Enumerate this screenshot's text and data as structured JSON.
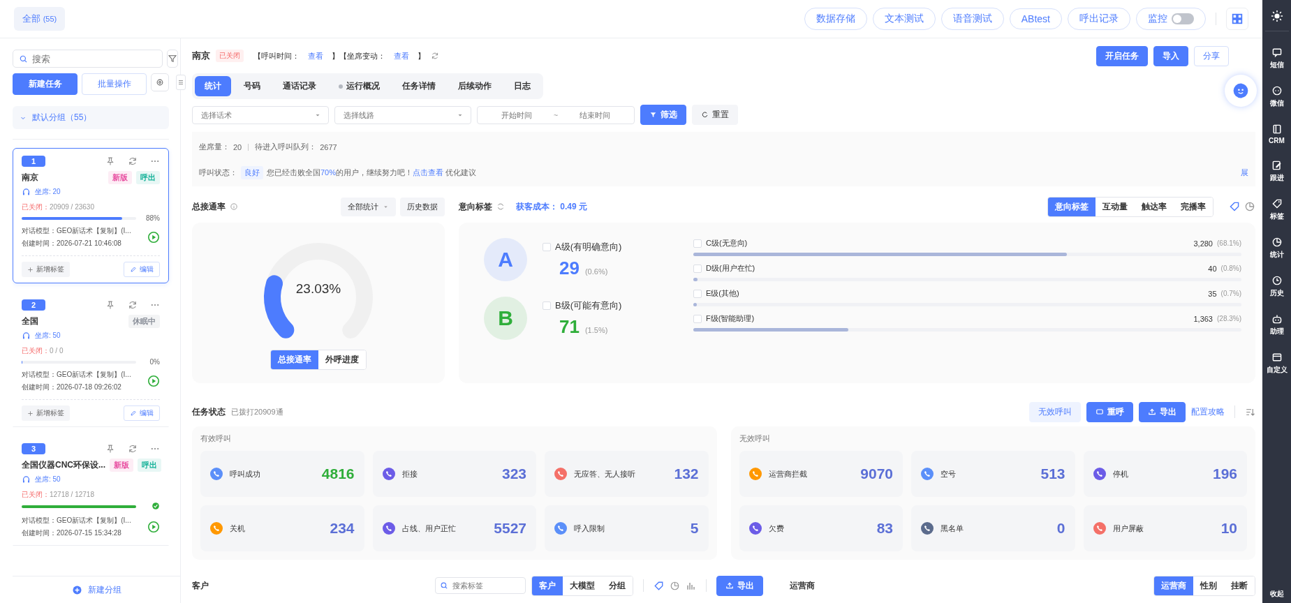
{
  "top_bar": {
    "all_tab": {
      "label": "全部",
      "count": "(55)"
    },
    "buttons": [
      "数据存储",
      "文本测试",
      "语音测试",
      "ABtest",
      "呼出记录"
    ],
    "monitor": {
      "label": "监控",
      "on": false
    }
  },
  "left_panel": {
    "search_placeholder": "搜索",
    "new_task": "新建任务",
    "batch": "批量操作",
    "group": {
      "label": "默认分组（55）",
      "expanded": true
    },
    "tasks": [
      {
        "number": "1",
        "name": "南京",
        "selected": true,
        "tags": [
          {
            "label": "新版",
            "color": "#e84fa1"
          },
          {
            "label": "呼出",
            "color": "#19b39b"
          }
        ],
        "seats": "坐席: 20",
        "closed_label": "已关闭：",
        "closed_value": "20909 / 23630",
        "level": 0.88,
        "percent": "88%",
        "done": false,
        "model": "对话模型：GEO新话术【复制】(I...",
        "created": "创建时间：2026-07-21 10:46:08",
        "add_tag": "新增标签",
        "edit": "编辑"
      },
      {
        "number": "2",
        "name": "全国",
        "selected": false,
        "tags": [
          {
            "label": "休眠中",
            "color": "#8a8f99"
          }
        ],
        "seats": "坐席: 50",
        "closed_label": "已关闭：",
        "closed_value": "0 / 0",
        "level": 0,
        "percent": "0%",
        "done": false,
        "model": "对话模型：GEO新话术【复制】(I...",
        "created": "创建时间：2026-07-18 09:26:02",
        "add_tag": "新增标签",
        "edit": "编辑"
      },
      {
        "number": "3",
        "name": "全国仪器CNC环保设...",
        "selected": false,
        "tags": [
          {
            "label": "新版",
            "color": "#e84fa1"
          },
          {
            "label": "呼出",
            "color": "#19b39b"
          }
        ],
        "seats": "坐席: 50",
        "closed_label": "已关闭：",
        "closed_value": "12718 / 12718",
        "level": 1,
        "done": true,
        "model": "对话模型：GEO新话术【复制】(I...",
        "created": "创建时间：2026-07-15 15:34:28"
      }
    ],
    "new_group": "新建分组"
  },
  "header": {
    "title": "南京",
    "status": "已关闭",
    "meta": [
      {
        "text": "【呼叫时间：",
        "kind": "text"
      },
      {
        "text": "查看",
        "kind": "link"
      },
      {
        "text": "】【坐席变动：",
        "kind": "text"
      },
      {
        "text": "查看",
        "kind": "link"
      },
      {
        "text": "】",
        "kind": "text"
      }
    ],
    "actions": [
      {
        "label": "开启任务",
        "kind": "primary"
      },
      {
        "label": "导入",
        "kind": "primary"
      },
      {
        "label": "分享",
        "kind": "outline"
      }
    ]
  },
  "tabs": [
    {
      "label": "统计",
      "selected": true,
      "dot": false
    },
    {
      "label": "号码",
      "selected": false,
      "dot": false
    },
    {
      "label": "通话记录",
      "selected": false,
      "dot": false
    },
    {
      "label": "运行概况",
      "selected": false,
      "dot": true
    },
    {
      "label": "任务详情",
      "selected": false,
      "dot": false
    },
    {
      "label": "后续动作",
      "selected": false,
      "dot": false
    },
    {
      "label": "日志",
      "selected": false,
      "dot": false
    }
  ],
  "filters": {
    "script_placeholder": "选择话术",
    "line_placeholder": "选择线路",
    "start_placeholder": "开始时间",
    "separator": "~",
    "end_placeholder": "结束时间",
    "filter_button": "筛选",
    "reset_button": "重置"
  },
  "info": {
    "seats_label": "坐席量：",
    "seats": "20",
    "queue_label": "待进入呼叫队列：",
    "queue": "2677",
    "status_label": "呼叫状态：",
    "status": "良好",
    "message_before": "您已经击败全国",
    "message_highlight": "70%",
    "message_after": "的用户，继续努力吧！",
    "link": "点击查看",
    "link_after": "优化建议",
    "expand": "展"
  },
  "connect_rate": {
    "title": "总接通率",
    "scope": "全部统计",
    "history": "历史数据",
    "value": "23.03%",
    "level": 0.2303,
    "views": [
      {
        "label": "总接通率",
        "selected": true
      },
      {
        "label": "外呼进度",
        "selected": false
      }
    ]
  },
  "intent": {
    "title": "意向标签",
    "cost": "获客成本： 0.49 元",
    "modes": [
      {
        "label": "意向标签",
        "selected": true
      },
      {
        "label": "互动量",
        "selected": false
      },
      {
        "label": "触达率",
        "selected": false
      },
      {
        "label": "完播率",
        "selected": false
      }
    ],
    "primary": [
      {
        "letter": "A",
        "label": "A级(有明确意向)",
        "count": "29",
        "share": "(0.6%)",
        "color": "#4d7cfe",
        "checked": false
      },
      {
        "letter": "B",
        "label": "B级(可能有意向)",
        "count": "71",
        "share": "(1.5%)",
        "color": "#2fae3a",
        "checked": false
      }
    ],
    "levels": [
      {
        "label": "C级(无意向)",
        "count": "3,280",
        "share": "(68.1%)",
        "level": 0.681,
        "checked": false
      },
      {
        "label": "D级(用户在忙)",
        "count": "40",
        "share": "(0.8%)",
        "level": 0.008,
        "checked": false
      },
      {
        "label": "E级(其他)",
        "count": "35",
        "share": "(0.7%)",
        "level": 0.007,
        "checked": false
      },
      {
        "label": "F级(智能助理)",
        "count": "1,363",
        "share": "(28.3%)",
        "level": 0.283,
        "checked": false
      }
    ]
  },
  "task_status": {
    "title": "任务状态",
    "dialed": "已拨打20909通",
    "invalid_button": "无效呼叫",
    "redial": "重呼",
    "export": "导出",
    "guide": "配置攻略",
    "groups": [
      {
        "title": "有效呼叫",
        "tiles": [
          {
            "label": "呼叫成功",
            "value": "4816",
            "color": "#5b8ff9",
            "highlight": true
          },
          {
            "label": "拒接",
            "value": "323",
            "color": "#6c5ce7",
            "highlight": false
          },
          {
            "label": "无应答、无人接听",
            "value": "132",
            "color": "#f47068",
            "highlight": false
          },
          {
            "label": "关机",
            "value": "234",
            "color": "#ff9800",
            "highlight": false
          },
          {
            "label": "占线、用户正忙",
            "value": "5527",
            "color": "#6c5ce7",
            "highlight": false
          },
          {
            "label": "呼入限制",
            "value": "5",
            "color": "#5b8ff9",
            "highlight": false
          }
        ]
      },
      {
        "title": "无效呼叫",
        "tiles": [
          {
            "label": "运营商拦截",
            "value": "9070",
            "color": "#ff9800",
            "highlight": false
          },
          {
            "label": "空号",
            "value": "513",
            "color": "#5b8ff9",
            "highlight": false
          },
          {
            "label": "停机",
            "value": "196",
            "color": "#6c5ce7",
            "highlight": false
          },
          {
            "label": "欠费",
            "value": "83",
            "color": "#6c5ce7",
            "highlight": false
          },
          {
            "label": "黑名单",
            "value": "0",
            "color": "#5b6b8c",
            "highlight": false
          },
          {
            "label": "用户屏蔽",
            "value": "10",
            "color": "#f47068",
            "highlight": false
          }
        ]
      }
    ]
  },
  "customers": {
    "title": "客户",
    "search_placeholder": "搜索标签",
    "views": [
      {
        "label": "客户",
        "selected": true
      },
      {
        "label": "大模型",
        "selected": false
      },
      {
        "label": "分组",
        "selected": false
      }
    ],
    "export": "导出",
    "carrier_title": "运营商",
    "carrier_views": [
      {
        "label": "运营商",
        "selected": true
      },
      {
        "label": "性别",
        "selected": false
      },
      {
        "label": "挂断",
        "selected": false
      }
    ]
  },
  "side_nav": {
    "items": [
      "短信",
      "微信",
      "CRM",
      "跟进",
      "标签",
      "统计",
      "历史",
      "助理",
      "自定义"
    ],
    "collapse": "收起"
  }
}
